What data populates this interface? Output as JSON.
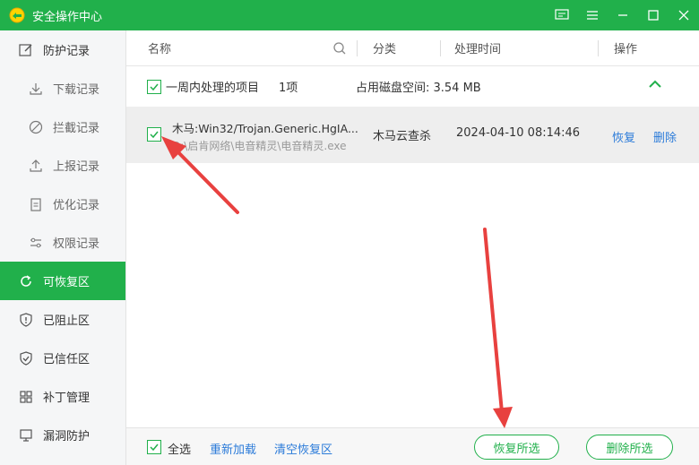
{
  "window": {
    "title": "安全操作中心"
  },
  "sidebar": {
    "items": [
      {
        "label": "防护记录",
        "icon": "edit-icon"
      },
      {
        "label": "下载记录",
        "icon": "download-icon"
      },
      {
        "label": "拦截记录",
        "icon": "block-icon"
      },
      {
        "label": "上报记录",
        "icon": "upload-icon"
      },
      {
        "label": "优化记录",
        "icon": "clipboard-icon"
      },
      {
        "label": "权限记录",
        "icon": "sliders-icon"
      },
      {
        "label": "可恢复区",
        "icon": "restore-icon"
      },
      {
        "label": "已阻止区",
        "icon": "shield-alert-icon"
      },
      {
        "label": "已信任区",
        "icon": "shield-check-icon"
      },
      {
        "label": "补丁管理",
        "icon": "grid-icon"
      },
      {
        "label": "漏洞防护",
        "icon": "monitor-icon"
      }
    ]
  },
  "columns": {
    "name": "名称",
    "category": "分类",
    "time": "处理时间",
    "operation": "操作"
  },
  "group": {
    "label": "一周内处理的项目",
    "count": "1项",
    "size": "占用磁盘空间: 3.54 MB"
  },
  "item": {
    "name": "木马:Win32/Trojan.Generic.HgIA...",
    "path": "D:\\启肯网络\\电音精灵\\电音精灵.exe",
    "category": "木马云查杀",
    "time": "2024-04-10 08:14:46",
    "restore": "恢复",
    "delete": "删除"
  },
  "footer": {
    "select_all": "全选",
    "reload": "重新加载",
    "clear": "清空恢复区",
    "restore_selected": "恢复所选",
    "delete_selected": "删除所选"
  },
  "colors": {
    "accent": "#21b04b",
    "link": "#2b7bd9",
    "arrow": "#e8413f"
  }
}
